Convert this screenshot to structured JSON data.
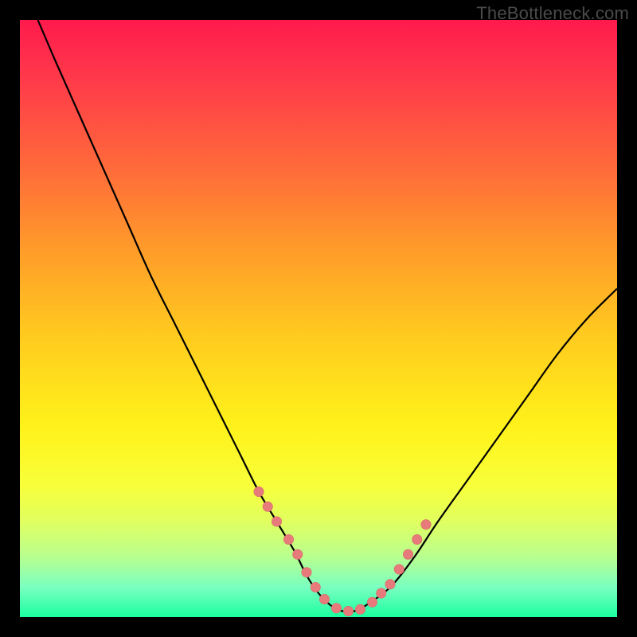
{
  "watermark": "TheBottleneck.com",
  "colors": {
    "curve_stroke": "#000000",
    "marker_fill": "#e77b7b",
    "marker_stroke": "#d96a6a",
    "frame": "#000000"
  },
  "chart_data": {
    "type": "line",
    "title": "",
    "xlabel": "",
    "ylabel": "",
    "xlim": [
      0,
      100
    ],
    "ylim": [
      0,
      100
    ],
    "series": [
      {
        "name": "bottleneck-curve",
        "x": [
          3,
          6,
          10,
          14,
          18,
          22,
          26,
          30,
          34,
          37,
          40,
          43,
          46,
          48,
          50,
          52,
          54,
          56,
          58,
          62,
          66,
          70,
          75,
          80,
          85,
          90,
          95,
          100
        ],
        "y": [
          100,
          93,
          84,
          75,
          66,
          57,
          49,
          41,
          33,
          27,
          21,
          16,
          11,
          7,
          4,
          2,
          1,
          1,
          2,
          5,
          10,
          16,
          23,
          30,
          37,
          44,
          50,
          55
        ]
      }
    ],
    "markers": {
      "name": "highlight-dots",
      "x": [
        40,
        41.5,
        43,
        45,
        46.5,
        48,
        49.5,
        51,
        53,
        55,
        57,
        59,
        60.5,
        62,
        63.5,
        65,
        66.5,
        68
      ],
      "y": [
        21,
        18.5,
        16,
        13,
        10.5,
        7.5,
        5,
        3,
        1.5,
        1,
        1.3,
        2.5,
        4,
        5.5,
        8,
        10.5,
        13,
        15.5
      ]
    }
  }
}
